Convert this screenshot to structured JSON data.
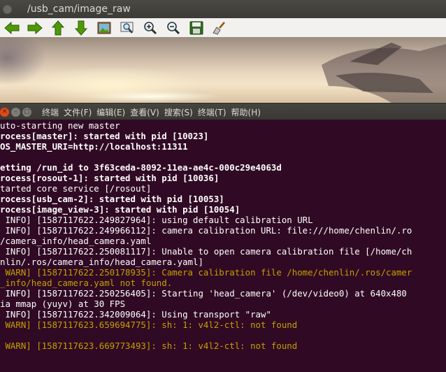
{
  "image_window": {
    "title": "/usb_cam/image_raw",
    "toolbar": [
      {
        "icon": "arrow-left-icon",
        "label": ""
      },
      {
        "icon": "arrow-right-icon",
        "label": ""
      },
      {
        "icon": "arrow-up-icon",
        "label": ""
      },
      {
        "icon": "arrow-down-icon",
        "label": ""
      },
      {
        "icon": "image-icon",
        "label": ""
      },
      {
        "icon": "zoom-fit-icon",
        "label": ""
      },
      {
        "icon": "zoom-in-icon",
        "label": ""
      },
      {
        "icon": "zoom-out-icon",
        "label": ""
      },
      {
        "icon": "save-icon",
        "label": ""
      },
      {
        "icon": "clear-brush-icon",
        "label": ""
      }
    ]
  },
  "terminal": {
    "menu": [
      "终端",
      "文件(F)",
      "编辑(E)",
      "查看(V)",
      "搜索(S)",
      "终端(T)",
      "帮助(H)"
    ],
    "colors": {
      "background": "#300a24",
      "text": "#ffffff",
      "warn": "#c4a000",
      "close": "#df4a16"
    },
    "lines": [
      {
        "text": "uto-starting new master",
        "style": "info"
      },
      {
        "text": "rocess[master]: started with pid [10023]",
        "style": "bold"
      },
      {
        "text": "OS_MASTER_URI=http://localhost:11311",
        "style": "bold"
      },
      {
        "text": "",
        "style": "info"
      },
      {
        "text": "etting /run_id to 3f63ceda-8092-11ea-ae4c-000c29e4063d",
        "style": "bold"
      },
      {
        "text": "rocess[rosout-1]: started with pid [10036]",
        "style": "bold"
      },
      {
        "text": "tarted core service [/rosout]",
        "style": "info"
      },
      {
        "text": "rocess[usb_cam-2]: started with pid [10053]",
        "style": "bold"
      },
      {
        "text": "rocess[image_view-3]: started with pid [10054]",
        "style": "bold"
      },
      {
        "text": " INFO] [1587117622.249827964]: using default calibration URL",
        "style": "info"
      },
      {
        "text": " INFO] [1587117622.249966112]: camera calibration URL: file:///home/chenlin/.ro",
        "style": "info"
      },
      {
        "text": "/camera_info/head_camera.yaml",
        "style": "info"
      },
      {
        "text": " INFO] [1587117622.250081117]: Unable to open camera calibration file [/home/ch",
        "style": "info"
      },
      {
        "text": "nlin/.ros/camera_info/head_camera.yaml]",
        "style": "info"
      },
      {
        "text": " WARN] [1587117622.250178935]: Camera calibration file /home/chenlin/.ros/camer",
        "style": "warn"
      },
      {
        "text": "_info/head_camera.yaml not found.",
        "style": "warn"
      },
      {
        "text": " INFO] [1587117622.250256405]: Starting 'head_camera' (/dev/video0) at 640x480",
        "style": "info"
      },
      {
        "text": "ia mmap (yuyv) at 30 FPS",
        "style": "info"
      },
      {
        "text": " INFO] [1587117622.342009064]: Using transport \"raw\"",
        "style": "info"
      },
      {
        "text": " WARN] [1587117623.659694775]: sh: 1: v4l2-ctl: not found",
        "style": "warn"
      },
      {
        "text": "",
        "style": "info"
      },
      {
        "text": " WARN] [1587117623.669773493]: sh: 1: v4l2-ctl: not found",
        "style": "warn"
      }
    ]
  }
}
